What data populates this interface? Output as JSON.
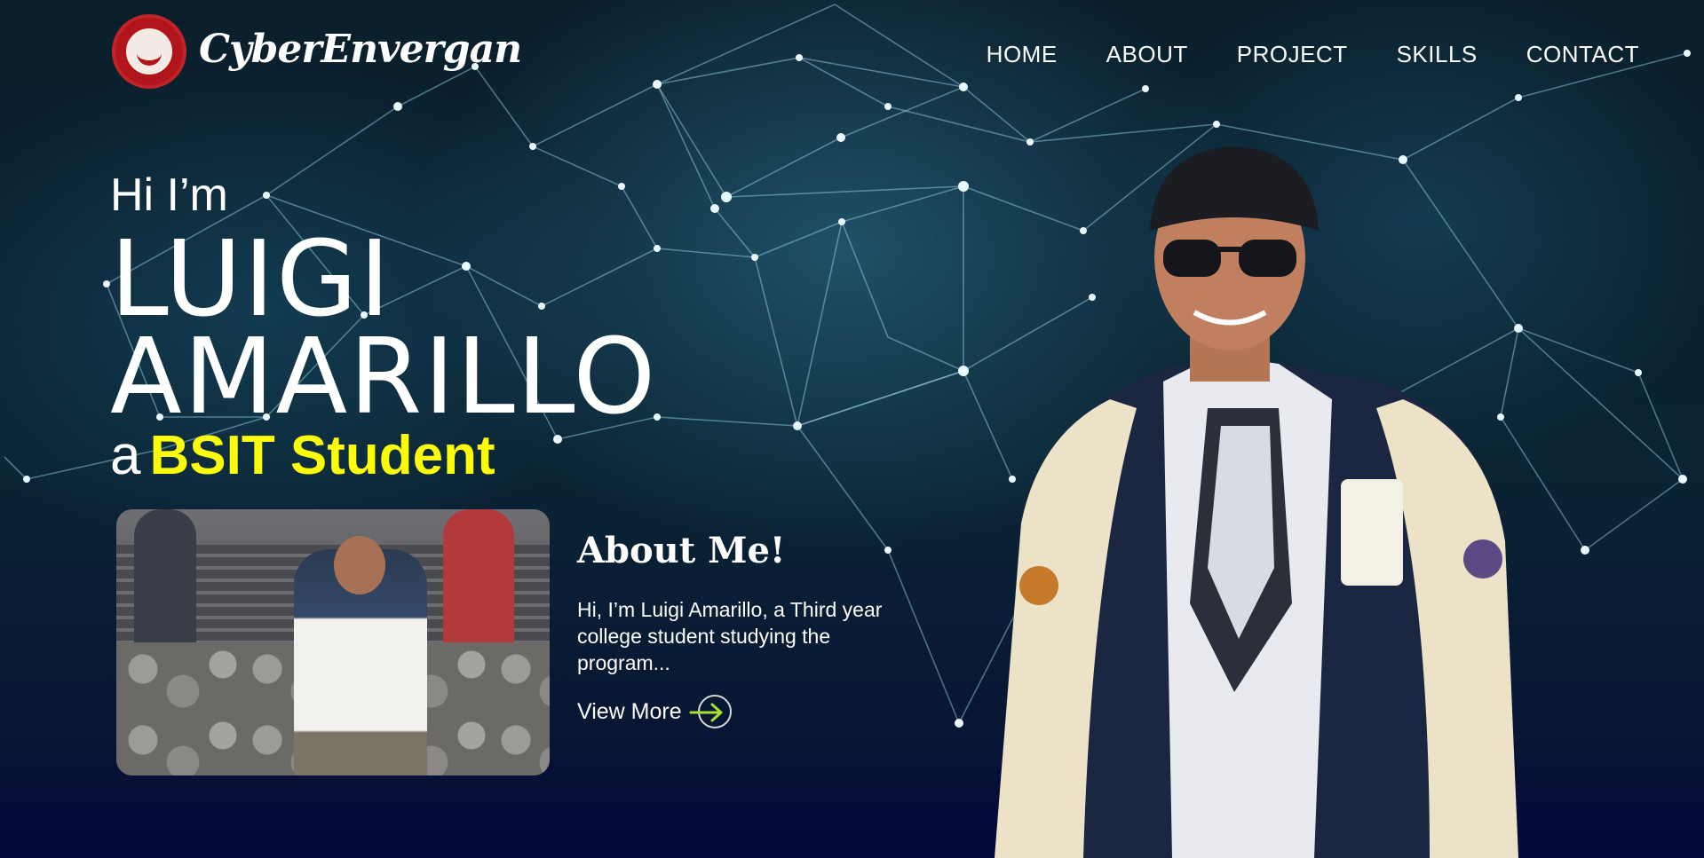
{
  "header": {
    "brand": "CyberEnvergan",
    "nav": [
      "HOME",
      "ABOUT",
      "PROJECT",
      "SKILLS",
      "CONTACT"
    ]
  },
  "hero": {
    "greeting": "Hi I’m",
    "name_line1": "LUIGI",
    "name_line2": "AMARILLO",
    "role_prefix": "a",
    "role_highlight": "BSIT Student"
  },
  "about": {
    "title": "About Me!",
    "text": "Hi, I’m Luigi Amarillo, a Third year college student studying the program...",
    "cta": "View More"
  },
  "colors": {
    "accent_yellow": "#fbfb0a",
    "arrow_green": "#a6e22e",
    "background": "#061724"
  },
  "icons": {
    "logo": "university-seal-icon",
    "cta": "arrow-right-circle-icon"
  }
}
